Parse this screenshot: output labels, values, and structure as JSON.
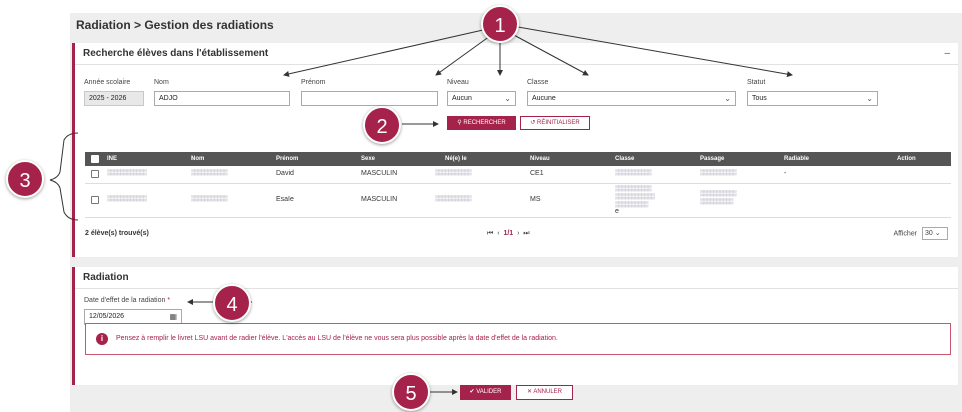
{
  "header": {
    "title": "Radiation > Gestion des radiations"
  },
  "search": {
    "title": "Recherche élèves dans l'établissement",
    "collapse_icon": "minus-icon",
    "annee_label": "Année scolaire",
    "annee_value": "2025 - 2026",
    "nom_label": "Nom",
    "nom_value": "ADJO",
    "prenom_label": "Prénom",
    "prenom_value": "",
    "niveau_label": "Niveau",
    "niveau_value": "Aucun",
    "classe_label": "Classe",
    "classe_value": "Aucune",
    "statut_label": "Statut",
    "statut_value": "Tous",
    "search_button": "RECHERCHER",
    "reset_button": "RÉINITIALISER"
  },
  "table": {
    "columns": [
      "INE",
      "Nom",
      "Prénom",
      "Sexe",
      "Né(e) le",
      "Niveau",
      "Classe",
      "Passage",
      "Radiable",
      "Action"
    ],
    "rows": [
      {
        "prenom": "David",
        "sexe": "MASCULIN",
        "niveau": "CE1",
        "radiable": "-"
      },
      {
        "prenom": "Esaïe",
        "sexe": "MASCULIN",
        "niveau": "MS",
        "classe_suffix": "e"
      }
    ],
    "count": "2 élève(s) trouvé(s)",
    "pagination": {
      "first": "⏮",
      "prev": "‹",
      "current": "1/1",
      "next": "›",
      "last": "⏭"
    },
    "afficher_label": "Afficher",
    "afficher_value": "30"
  },
  "radiation": {
    "title": "Radiation",
    "date_label": "Date d'effet de la radiation",
    "required_mark": "*",
    "date_value": "12/05/2026",
    "alert": "Pensez à remplir le livret LSU avant de radier l'élève. L'accès au LSU de l'élève ne vous sera plus possible après la date d'effet de la radiation."
  },
  "footer": {
    "validate_button": "VALIDER",
    "cancel_button": "ANNULER"
  },
  "annotations": [
    "1",
    "2",
    "3",
    "4",
    "5"
  ],
  "colors": {
    "accent": "#a5234a",
    "table_header": "#555555",
    "background": "#eeeeee"
  }
}
